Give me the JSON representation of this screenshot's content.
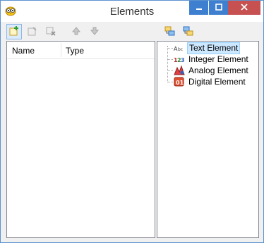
{
  "window": {
    "title": "Elements",
    "icons": {
      "app": "owl-icon",
      "minimize": "minimize-icon",
      "maximize": "maximize-icon",
      "close": "close-icon"
    }
  },
  "toolbar_left": [
    {
      "name": "add-element-button",
      "icon": "add-element-icon",
      "enabled": true,
      "active": true
    },
    {
      "name": "edit-element-button",
      "icon": "edit-element-icon",
      "enabled": false
    },
    {
      "name": "delete-element-button",
      "icon": "delete-element-icon",
      "enabled": false
    },
    {
      "name": "move-up-button",
      "icon": "arrow-up-icon",
      "enabled": false
    },
    {
      "name": "move-down-button",
      "icon": "arrow-down-icon",
      "enabled": false
    }
  ],
  "toolbar_right": [
    {
      "name": "expand-all-button",
      "icon": "expand-tree-icon"
    },
    {
      "name": "collapse-all-button",
      "icon": "collapse-tree-icon"
    }
  ],
  "list": {
    "columns": [
      "Name",
      "Type"
    ],
    "rows": []
  },
  "tree": {
    "items": [
      {
        "label": "Text Element",
        "icon": "text-element-icon",
        "selected": true
      },
      {
        "label": "Integer Element",
        "icon": "integer-element-icon",
        "selected": false
      },
      {
        "label": "Analog Element",
        "icon": "analog-element-icon",
        "selected": false
      },
      {
        "label": "Digital Element",
        "icon": "digital-element-icon",
        "selected": false
      }
    ]
  },
  "colors": {
    "caption_blue": "#3f7fcf",
    "caption_close": "#c75050",
    "selection_fill": "#cce8ff",
    "selection_border": "#99d1ff",
    "window_border": "#5b93d0"
  }
}
